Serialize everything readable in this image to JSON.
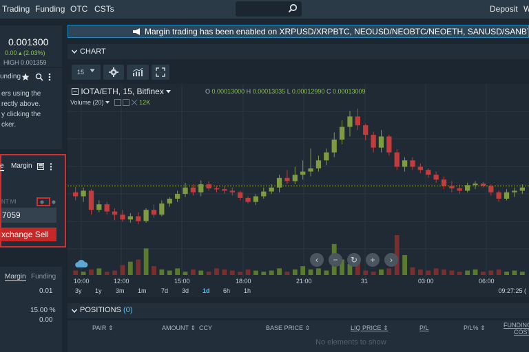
{
  "nav": {
    "trading": "Trading",
    "funding": "Funding",
    "otc": "OTC",
    "csts": "CSTs",
    "deposit": "Deposit",
    "w": "W"
  },
  "ticker": {
    "price": "0.001300",
    "change": "0.00 ▴ (2.03%)",
    "high": "HIGH 0.001359"
  },
  "panel1": {
    "tab": "unding",
    "lines": [
      "ers using the",
      "rectly above.",
      "y clicking the",
      "cker."
    ]
  },
  "order_panel": {
    "tab_active": "e",
    "tab_margin": "Margin",
    "amount_label": "NT MI",
    "amount_value": "7059",
    "sell_label": "xchange Sell"
  },
  "panel3": {
    "tab_margin": "Margin",
    "tab_funding": "Funding",
    "val1": "0.01",
    "val2": "15.00 %",
    "val3": "0.00"
  },
  "announcement": "Margin trading has been enabled on XRPUSD/XRPBTC, NEOUSD/NEOBTC/NEOETH, SANUSD/SANBTC/",
  "chart": {
    "section_title": "CHART",
    "interval": "15",
    "symbol": "IOTA/ETH, 15, Bitfinex",
    "ohlc": {
      "o_label": "O",
      "o": "0.00013000",
      "h_label": "H",
      "h": "0.00013035",
      "l_label": "L",
      "l": "0.00012990",
      "c_label": "C",
      "c": "0.00013009"
    },
    "volume_label": "Volume (20)",
    "volume_value": "12K",
    "time_labels": [
      "10:00",
      "12:00",
      "15:00",
      "18:00",
      "21:00",
      "31",
      "03:00",
      "06:00"
    ],
    "ranges": [
      "3y",
      "1y",
      "3m",
      "1m",
      "7d",
      "3d",
      "1d",
      "6h",
      "1h"
    ],
    "active_range": "1d",
    "clock": "09:27:25 ("
  },
  "chart_data": {
    "type": "candlestick",
    "x": [
      "10:00",
      "12:00",
      "15:00",
      "18:00",
      "21:00",
      "31",
      "03:00",
      "06:00"
    ],
    "candles": [
      {
        "o": 0.000129,
        "h": 0.0001297,
        "l": 0.000128,
        "c": 0.0001285
      },
      {
        "o": 0.0001285,
        "h": 0.0001296,
        "l": 0.0001278,
        "c": 0.0001292
      },
      {
        "o": 0.0001292,
        "h": 0.0001294,
        "l": 0.0001262,
        "c": 0.0001268
      },
      {
        "o": 0.0001268,
        "h": 0.000128,
        "l": 0.0001265,
        "c": 0.0001275
      },
      {
        "o": 0.0001275,
        "h": 0.0001278,
        "l": 0.0001262,
        "c": 0.0001266
      },
      {
        "o": 0.0001266,
        "h": 0.000127,
        "l": 0.0001255,
        "c": 0.0001262
      },
      {
        "o": 0.0001262,
        "h": 0.0001268,
        "l": 0.0001253,
        "c": 0.0001256
      },
      {
        "o": 0.0001256,
        "h": 0.0001264,
        "l": 0.0001252,
        "c": 0.000126
      },
      {
        "o": 0.000126,
        "h": 0.0001265,
        "l": 0.000125,
        "c": 0.0001254
      },
      {
        "o": 0.0001254,
        "h": 0.000127,
        "l": 0.0001252,
        "c": 0.0001268
      },
      {
        "o": 0.0001268,
        "h": 0.0001275,
        "l": 0.0001258,
        "c": 0.0001262
      },
      {
        "o": 0.0001262,
        "h": 0.000128,
        "l": 0.000126,
        "c": 0.0001276
      },
      {
        "o": 0.0001276,
        "h": 0.0001284,
        "l": 0.0001272,
        "c": 0.0001282
      },
      {
        "o": 0.0001282,
        "h": 0.0001292,
        "l": 0.0001278,
        "c": 0.0001288
      },
      {
        "o": 0.0001288,
        "h": 0.0001302,
        "l": 0.0001284,
        "c": 0.0001296
      },
      {
        "o": 0.0001296,
        "h": 0.00013,
        "l": 0.0001286,
        "c": 0.000129
      },
      {
        "o": 0.000129,
        "h": 0.0001305,
        "l": 0.0001285,
        "c": 0.00013
      },
      {
        "o": 0.00013,
        "h": 0.0001304,
        "l": 0.0001292,
        "c": 0.0001295
      },
      {
        "o": 0.0001295,
        "h": 0.0001298,
        "l": 0.000129,
        "c": 0.0001294
      },
      {
        "o": 0.0001294,
        "h": 0.0001298,
        "l": 0.0001288,
        "c": 0.0001292
      },
      {
        "o": 0.0001292,
        "h": 0.0001296,
        "l": 0.0001286,
        "c": 0.000129
      },
      {
        "o": 0.000129,
        "h": 0.0001292,
        "l": 0.000128,
        "c": 0.0001283
      },
      {
        "o": 0.0001283,
        "h": 0.0001285,
        "l": 0.0001276,
        "c": 0.0001278
      },
      {
        "o": 0.0001278,
        "h": 0.0001288,
        "l": 0.0001274,
        "c": 0.0001285
      },
      {
        "o": 0.0001285,
        "h": 0.0001296,
        "l": 0.0001282,
        "c": 0.0001291
      },
      {
        "o": 0.0001291,
        "h": 0.00013,
        "l": 0.0001288,
        "c": 0.0001296
      },
      {
        "o": 0.0001296,
        "h": 0.0001312,
        "l": 0.000129,
        "c": 0.0001308
      },
      {
        "o": 0.0001308,
        "h": 0.0001318,
        "l": 0.00013,
        "c": 0.0001304
      },
      {
        "o": 0.0001304,
        "h": 0.0001322,
        "l": 0.00013,
        "c": 0.0001312
      },
      {
        "o": 0.0001312,
        "h": 0.000133,
        "l": 0.0001306,
        "c": 0.0001316
      },
      {
        "o": 0.0001316,
        "h": 0.0001345,
        "l": 0.000131,
        "c": 0.000132
      },
      {
        "o": 0.000132,
        "h": 0.0001336,
        "l": 0.0001316,
        "c": 0.000133
      },
      {
        "o": 0.000133,
        "h": 0.0001345,
        "l": 0.0001324,
        "c": 0.000134
      },
      {
        "o": 0.000134,
        "h": 0.0001365,
        "l": 0.0001334,
        "c": 0.0001356
      },
      {
        "o": 0.0001356,
        "h": 0.000138,
        "l": 0.000135,
        "c": 0.0001372
      },
      {
        "o": 0.0001372,
        "h": 0.0001392,
        "l": 0.000136,
        "c": 0.0001385
      },
      {
        "o": 0.0001385,
        "h": 0.0001395,
        "l": 0.0001368,
        "c": 0.0001374
      },
      {
        "o": 0.0001374,
        "h": 0.0001376,
        "l": 0.0001355,
        "c": 0.0001362
      },
      {
        "o": 0.0001362,
        "h": 0.0001366,
        "l": 0.000134,
        "c": 0.0001346
      },
      {
        "o": 0.0001346,
        "h": 0.0001368,
        "l": 0.000134,
        "c": 0.000136
      },
      {
        "o": 0.000136,
        "h": 0.0001362,
        "l": 0.0001336,
        "c": 0.000134
      },
      {
        "o": 0.000134,
        "h": 0.0001344,
        "l": 0.0001318,
        "c": 0.0001322
      },
      {
        "o": 0.0001322,
        "h": 0.0001334,
        "l": 0.0001316,
        "c": 0.000133
      },
      {
        "o": 0.000133,
        "h": 0.0001334,
        "l": 0.0001318,
        "c": 0.0001322
      },
      {
        "o": 0.0001322,
        "h": 0.0001326,
        "l": 0.0001314,
        "c": 0.0001318
      },
      {
        "o": 0.0001318,
        "h": 0.000132,
        "l": 0.0001308,
        "c": 0.0001312
      },
      {
        "o": 0.0001312,
        "h": 0.0001316,
        "l": 0.0001302,
        "c": 0.0001306
      },
      {
        "o": 0.0001306,
        "h": 0.000131,
        "l": 0.0001294,
        "c": 0.0001298
      },
      {
        "o": 0.0001298,
        "h": 0.0001304,
        "l": 0.000129,
        "c": 0.0001295
      },
      {
        "o": 0.0001295,
        "h": 0.00013,
        "l": 0.0001288,
        "c": 0.0001292
      },
      {
        "o": 0.0001292,
        "h": 0.0001302,
        "l": 0.000129,
        "c": 0.0001299
      },
      {
        "o": 0.0001299,
        "h": 0.0001304,
        "l": 0.0001294,
        "c": 0.0001301
      },
      {
        "o": 0.0001301,
        "h": 0.0001303,
        "l": 0.0001296,
        "c": 0.0001298
      },
      {
        "o": 0.0001298,
        "h": 0.00013,
        "l": 0.0001286,
        "c": 0.000129
      },
      {
        "o": 0.000129,
        "h": 0.0001292,
        "l": 0.0001278,
        "c": 0.0001282
      },
      {
        "o": 0.0001282,
        "h": 0.0001294,
        "l": 0.000128,
        "c": 0.000129
      },
      {
        "o": 0.000129,
        "h": 0.0001296,
        "l": 0.0001284,
        "c": 0.0001292
      },
      {
        "o": 0.0001292,
        "h": 0.00013,
        "l": 0.0001288,
        "c": 0.0001296
      }
    ],
    "volumes": [
      4,
      3,
      5,
      6,
      3,
      4,
      9,
      12,
      14,
      24,
      8,
      5,
      4,
      6,
      3,
      5,
      4,
      3,
      6,
      5,
      4,
      3,
      5,
      4,
      3,
      4,
      6,
      3,
      5,
      8,
      5,
      6,
      4,
      28,
      14,
      10,
      16,
      4,
      3,
      5,
      6,
      36,
      18,
      7,
      5,
      4,
      6,
      5,
      4,
      3,
      4,
      5,
      3,
      4,
      5,
      3,
      4,
      3
    ],
    "ylim": [
      0.0001245,
      0.00014
    ],
    "reference_line": 0.0001298,
    "colors": {
      "up": "#7e9b3f",
      "down": "#c43b3b",
      "volume_up": "#5a7a2e",
      "volume_down": "#7a2e2e"
    }
  },
  "positions": {
    "title": "POSITIONS",
    "count": "(0)",
    "columns": [
      "PAIR ⇕",
      "AMOUNT ⇕",
      "CCY",
      "BASE PRICE ⇕",
      "LIQ PRICE ⇕",
      "P/L",
      "P/L% ⇕",
      "FUNDING COST"
    ],
    "empty": "No elements to show"
  }
}
